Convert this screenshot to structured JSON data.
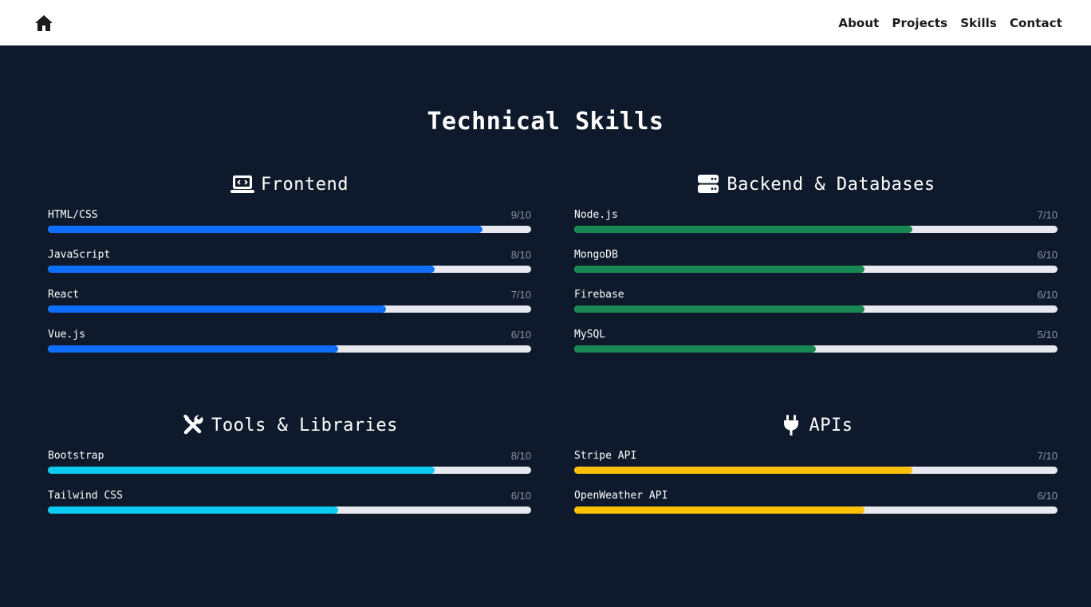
{
  "nav": {
    "home_icon": "home-icon",
    "links": [
      "About",
      "Projects",
      "Skills",
      "Contact"
    ]
  },
  "title": "Technical Skills",
  "colors": {
    "background": "#0e1a2b",
    "frontend": "#0d6efd",
    "backend": "#198754",
    "tools": "#0dcaf0",
    "apis": "#ffc107",
    "track": "#e8e9ee"
  },
  "groups": [
    {
      "id": "frontend",
      "title": "Frontend",
      "icon": "laptop-code-icon",
      "color": "#0d6efd",
      "skills": [
        {
          "name": "HTML/CSS",
          "score": "9/10",
          "level": 0.9
        },
        {
          "name": "JavaScript",
          "score": "8/10",
          "level": 0.8
        },
        {
          "name": "React",
          "score": "7/10",
          "level": 0.7
        },
        {
          "name": "Vue.js",
          "score": "6/10",
          "level": 0.6
        }
      ]
    },
    {
      "id": "backend",
      "title": "Backend & Databases",
      "icon": "server-icon",
      "color": "#198754",
      "skills": [
        {
          "name": "Node.js",
          "score": "7/10",
          "level": 0.7
        },
        {
          "name": "MongoDB",
          "score": "6/10",
          "level": 0.6
        },
        {
          "name": "Firebase",
          "score": "6/10",
          "level": 0.6
        },
        {
          "name": "MySQL",
          "score": "5/10",
          "level": 0.5
        }
      ]
    },
    {
      "id": "tools",
      "title": "Tools & Libraries",
      "icon": "tools-icon",
      "color": "#0dcaf0",
      "skills": [
        {
          "name": "Bootstrap",
          "score": "8/10",
          "level": 0.8
        },
        {
          "name": "Tailwind CSS",
          "score": "6/10",
          "level": 0.6
        }
      ]
    },
    {
      "id": "apis",
      "title": "APIs",
      "icon": "plug-icon",
      "color": "#ffc107",
      "skills": [
        {
          "name": "Stripe API",
          "score": "7/10",
          "level": 0.7
        },
        {
          "name": "OpenWeather API",
          "score": "6/10",
          "level": 0.6
        }
      ]
    }
  ]
}
